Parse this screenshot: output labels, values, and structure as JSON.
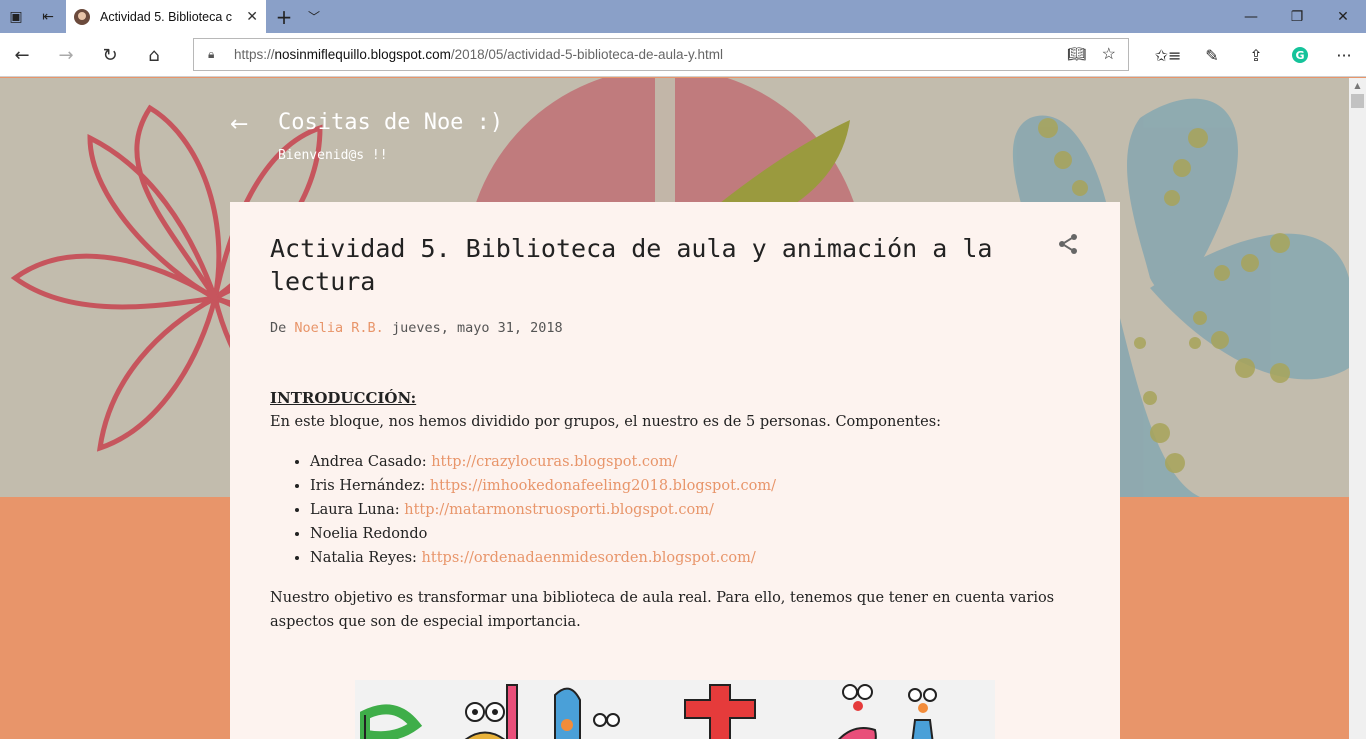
{
  "browser": {
    "tab_title": "Actividad 5. Biblioteca c",
    "new_tab": "+",
    "address": {
      "protocol": "https://",
      "host": "nosinmiflequillo.blogspot.com",
      "path": "/2018/05/actividad-5-biblioteca-de-aula-y.html"
    },
    "extension_letter": "G",
    "more": "···"
  },
  "blog": {
    "title": "Cositas de Noe :)",
    "subtitle": "Bienvenid@s !!"
  },
  "post": {
    "title": "Actividad 5. Biblioteca de aula y animación a la lectura",
    "by_prefix": "De",
    "author": "Noelia R.B.",
    "date": "jueves, mayo 31, 2018",
    "intro_heading": "INTRODUCCIÓN:",
    "intro_text": "En este bloque, nos hemos dividido por grupos, el nuestro es de 5 personas. Componentes:",
    "members": [
      {
        "name": "Andrea Casado: ",
        "link": "http://crazylocuras.blogspot.com/"
      },
      {
        "name": "Iris Hernández: ",
        "link": "https://imhookedonafeeling2018.blogspot.com/"
      },
      {
        "name": "Laura Luna: ",
        "link": "http://matarmonstruosporti.blogspot.com/"
      },
      {
        "name": "Noelia Redondo",
        "link": ""
      },
      {
        "name": "Natalia Reyes: ",
        "link": "https://ordenadaenmidesorden.blogspot.com/"
      }
    ],
    "objective": "Nuestro objetivo es transformar una biblioteca de aula real. Para ello, tenemos que tener en cuenta varios aspectos que son de especial importancia."
  },
  "colors": {
    "accent": "#e8956a",
    "hero_bg": "#c2bcad",
    "card_bg": "#fdf3ef"
  }
}
